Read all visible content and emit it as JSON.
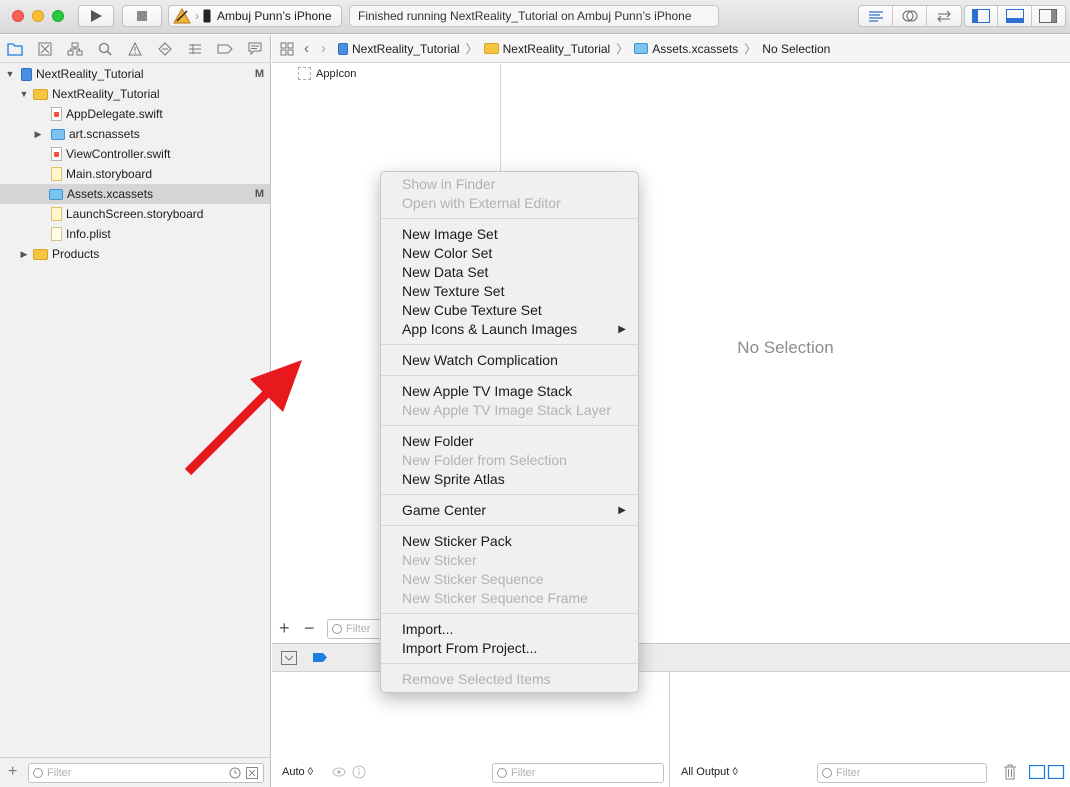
{
  "toolbar": {
    "scheme_device": "Ambuj Punn’s iPhone",
    "status": "Finished running NextReality_Tutorial on Ambuj Punn’s iPhone"
  },
  "navigator": {
    "tree": [
      {
        "label": "NextReality_Tutorial",
        "kind": "project",
        "badge": "M",
        "expanded": true
      },
      {
        "label": "NextReality_Tutorial",
        "kind": "folder",
        "expanded": true
      },
      {
        "label": "AppDelegate.swift",
        "kind": "swift"
      },
      {
        "label": "art.scnassets",
        "kind": "asset"
      },
      {
        "label": "ViewController.swift",
        "kind": "swift"
      },
      {
        "label": "Main.storyboard",
        "kind": "storyboard"
      },
      {
        "label": "Assets.xcassets",
        "kind": "asset",
        "badge": "M",
        "selected": true
      },
      {
        "label": "LaunchScreen.storyboard",
        "kind": "storyboard"
      },
      {
        "label": "Info.plist",
        "kind": "plist"
      },
      {
        "label": "Products",
        "kind": "folder"
      }
    ],
    "filter_placeholder": "Filter"
  },
  "jumpbar": {
    "crumbs": [
      "NextReality_Tutorial",
      "NextReality_Tutorial",
      "Assets.xcassets",
      "No Selection"
    ]
  },
  "asset_list": {
    "items": [
      "AppIcon"
    ],
    "filter_placeholder": "Filter"
  },
  "editor": {
    "no_selection": "No Selection"
  },
  "debug": {
    "auto_label": "Auto ◊",
    "all_output_label": "All Output ◊",
    "filter_placeholder": "Filter"
  },
  "context_menu": {
    "groups": [
      [
        {
          "label": "Show in Finder",
          "enabled": false
        },
        {
          "label": "Open with External Editor",
          "enabled": false
        }
      ],
      [
        {
          "label": "New Image Set",
          "enabled": true
        },
        {
          "label": "New Color Set",
          "enabled": true
        },
        {
          "label": "New Data Set",
          "enabled": true
        },
        {
          "label": "New Texture Set",
          "enabled": true
        },
        {
          "label": "New Cube Texture Set",
          "enabled": true
        },
        {
          "label": "App Icons & Launch Images",
          "enabled": true,
          "submenu": true
        }
      ],
      [
        {
          "label": "New Watch Complication",
          "enabled": true
        }
      ],
      [
        {
          "label": "New Apple TV Image Stack",
          "enabled": true
        },
        {
          "label": "New Apple TV Image Stack Layer",
          "enabled": false
        }
      ],
      [
        {
          "label": "New Folder",
          "enabled": true
        },
        {
          "label": "New Folder from Selection",
          "enabled": false
        },
        {
          "label": "New Sprite Atlas",
          "enabled": true
        }
      ],
      [
        {
          "label": "Game Center",
          "enabled": true,
          "submenu": true
        }
      ],
      [
        {
          "label": "New Sticker Pack",
          "enabled": true
        },
        {
          "label": "New Sticker",
          "enabled": false
        },
        {
          "label": "New Sticker Sequence",
          "enabled": false
        },
        {
          "label": "New Sticker Sequence Frame",
          "enabled": false
        }
      ],
      [
        {
          "label": "Import...",
          "enabled": true
        },
        {
          "label": "Import From Project...",
          "enabled": true
        }
      ],
      [
        {
          "label": "Remove Selected Items",
          "enabled": false
        }
      ]
    ]
  },
  "colors": {
    "arrow": "#e8191c",
    "accent": "#1b7ee0"
  }
}
